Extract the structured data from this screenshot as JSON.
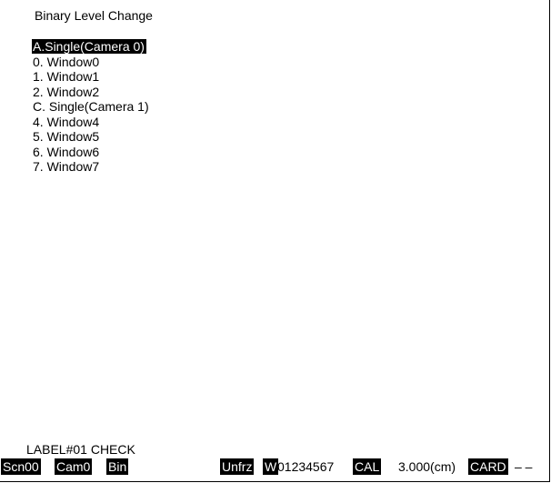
{
  "screen": {
    "title": "Binary Level Change",
    "menu_items": [
      {
        "label": "A.Single(Camera 0)",
        "selected": true
      },
      {
        "label": "0. Window0",
        "selected": false
      },
      {
        "label": "1. Window1",
        "selected": false
      },
      {
        "label": "2. Window2",
        "selected": false
      },
      {
        "label": "C. Single(Camera 1)",
        "selected": false
      },
      {
        "label": "4. Window4",
        "selected": false
      },
      {
        "label": "5. Window5",
        "selected": false
      },
      {
        "label": "6. Window6",
        "selected": false
      },
      {
        "label": "7. Window7",
        "selected": false
      }
    ],
    "label_check": "LABEL#01 CHECK"
  },
  "status": {
    "scene": "Scn00",
    "camera": "Cam0",
    "mode": "Bin",
    "freeze": "Unfrz",
    "window_prefix": "W",
    "window_digits": "01234567",
    "cal": "CAL",
    "scale": "3.000(cm)",
    "card": "CARD",
    "card_value": "– –"
  }
}
